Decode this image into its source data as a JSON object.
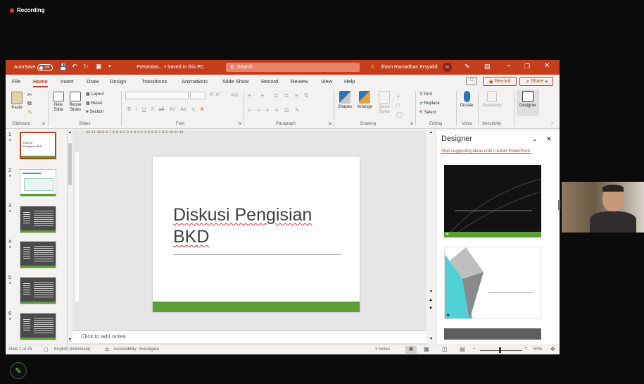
{
  "recording": {
    "label": "Recording"
  },
  "titlebar": {
    "autosave": "AutoSave",
    "autosave_state": "Off",
    "document": "Presentas... • Saved to this PC",
    "search_placeholder": "Search",
    "user": "Ilham Ramadhan Ersyafdi",
    "initials": "IR"
  },
  "menu": {
    "tabs": [
      "File",
      "Home",
      "Insert",
      "Draw",
      "Design",
      "Transitions",
      "Animations",
      "Slide Show",
      "Record",
      "Review",
      "View",
      "Help"
    ],
    "active": "Home",
    "record_btn": "Record",
    "share_btn": "Share"
  },
  "ribbon": {
    "clipboard": {
      "paste": "Paste",
      "label": "Clipboard"
    },
    "slides": {
      "new_slide": "New Slide",
      "reuse_slides": "Reuse Slides",
      "layout": "Layout",
      "reset": "Reset",
      "section": "Section",
      "label": "Slides"
    },
    "font": {
      "label": "Font",
      "format_buttons": [
        "B",
        "I",
        "U",
        "S",
        "ab",
        "AV",
        "Aa",
        "A"
      ]
    },
    "paragraph": {
      "label": "Paragraph"
    },
    "drawing": {
      "shapes": "Shapes",
      "arrange": "Arrange",
      "quick_styles": "Quick Styles",
      "label": "Drawing"
    },
    "editing": {
      "find": "Find",
      "replace": "Replace",
      "select": "Select",
      "label": "Editing"
    },
    "voice": {
      "dictate": "Dictate",
      "label": "Voice"
    },
    "sensitivity": {
      "sensitivity": "Sensitivity",
      "label": "Sensitivity"
    },
    "designer": {
      "label": "Designer"
    }
  },
  "ruler": {
    "h_ticks": "·12·11·10·9·8·7·6·5·4·3·2·1·0·1·2·3·4·5·6·7·8·9·10·11·12·"
  },
  "thumbnails": [
    {
      "num": "1",
      "selected": true,
      "text": "Diskusi Pengisian BKD"
    },
    {
      "num": "2",
      "selected": false
    },
    {
      "num": "3",
      "selected": false
    },
    {
      "num": "4",
      "selected": false
    },
    {
      "num": "5",
      "selected": false
    },
    {
      "num": "6",
      "selected": false
    }
  ],
  "slide": {
    "title_line1": "Diskusi Pengisian",
    "title_line2": "BKD",
    "accent": "#5a9e34"
  },
  "notes": {
    "placeholder": "Click to add notes"
  },
  "designer": {
    "title": "Designer",
    "stop_link": "Stop suggesting ideas until I restart PowerPoint."
  },
  "statusbar": {
    "slide_info": "Slide 1 of 25",
    "language": "English (Indonesia)",
    "accessibility": "Accessibility: Investigate",
    "notes": "Notes",
    "zoom": "50%"
  },
  "colors": {
    "brand": "#c43e1c",
    "accent_green": "#5a9e34",
    "recording_red": "#e3353b"
  }
}
